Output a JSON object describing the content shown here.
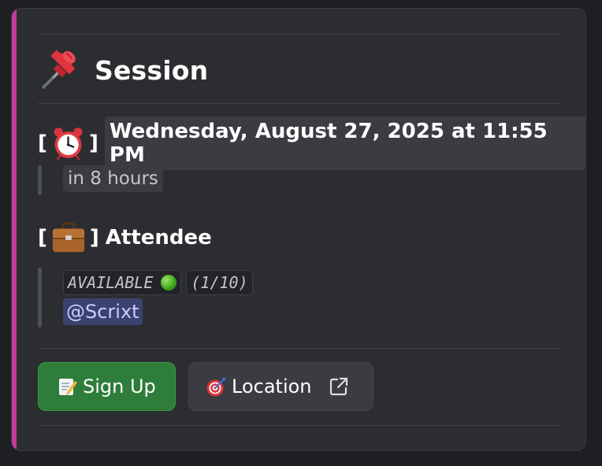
{
  "embed": {
    "accent_color": "#c03a9c",
    "title": {
      "icon": "pushpin-icon",
      "text": "Session"
    },
    "when": {
      "bracket_open": "[",
      "bracket_close": "]",
      "icon": "alarm-clock-icon",
      "datetime": "Wednesday, August 27, 2025 at 11:55 PM",
      "relative": "in 8 hours"
    },
    "attendee": {
      "bracket_open": "[",
      "bracket_close": "]",
      "icon": "briefcase-icon",
      "label": "Attendee",
      "status": "AVAILABLE",
      "status_icon": "green-circle-icon",
      "count": "(1/10)",
      "mention": "@Scrixt"
    },
    "buttons": {
      "signup": {
        "icon": "memo-icon",
        "label": "Sign Up",
        "color": "#2e7d3a"
      },
      "location": {
        "icon": "dart-target-icon",
        "label": "Location",
        "trailing_icon": "external-link-icon"
      }
    }
  }
}
